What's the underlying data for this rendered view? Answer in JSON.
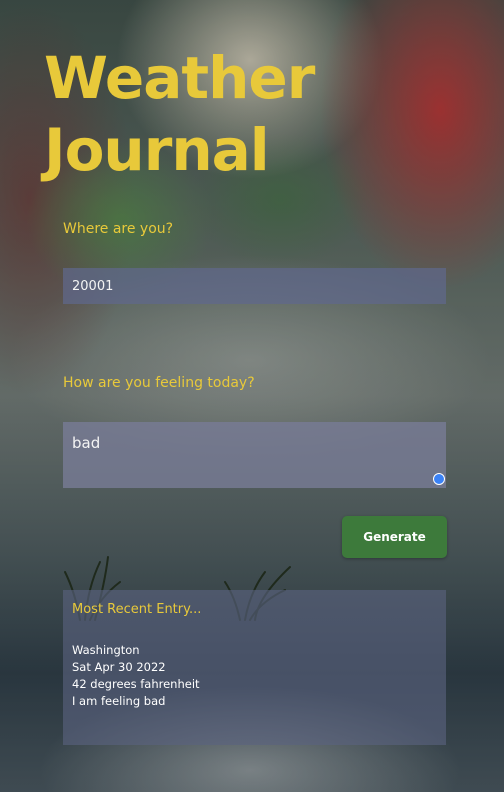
{
  "app": {
    "title": "Weather Journal"
  },
  "form": {
    "zip_label": "Where are you?",
    "zip_value": "20001",
    "feeling_label": "How are you feeling today?",
    "feeling_value": "bad",
    "generate_label": "Generate"
  },
  "entry": {
    "heading": "Most Recent Entry...",
    "city": "Washington",
    "date": "Sat Apr 30 2022",
    "temp": "42 degrees fahrenheit",
    "feeling": "I am feeling bad"
  },
  "colors": {
    "accent": "#e8c93a",
    "button": "#3d7a3b"
  }
}
